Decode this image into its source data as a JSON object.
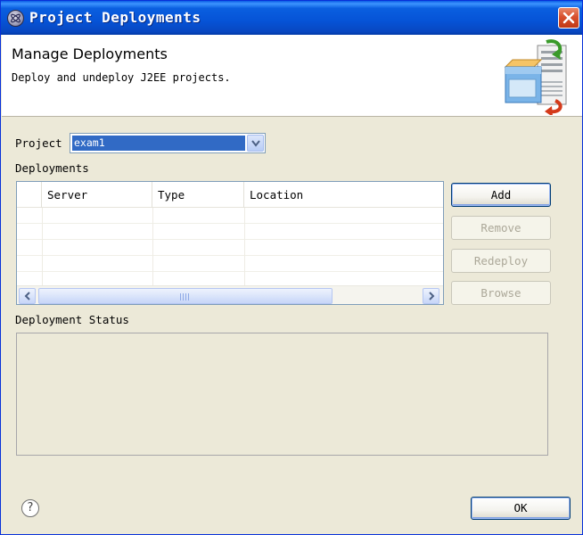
{
  "window": {
    "title": "Project Deployments",
    "icon": "eclipse-icon",
    "close_icon": "close-icon"
  },
  "header": {
    "title": "Manage Deployments",
    "description": "Deploy and undeploy J2EE projects.",
    "banner_icon": "deployment-banner-icon"
  },
  "form": {
    "project_label": "Project",
    "project_value": "exam1",
    "deployments_label": "Deployments",
    "status_label": "Deployment Status"
  },
  "table": {
    "columns": [
      "Server",
      "Type",
      "Location"
    ],
    "rows": []
  },
  "buttons": {
    "add": "Add",
    "remove": "Remove",
    "redeploy": "Redeploy",
    "browse": "Browse",
    "ok": "OK"
  },
  "help": {
    "glyph": "?"
  },
  "colors": {
    "titlebar": "#0a5fe0",
    "selection": "#316ac5",
    "dialog_bg": "#ece9d8"
  }
}
